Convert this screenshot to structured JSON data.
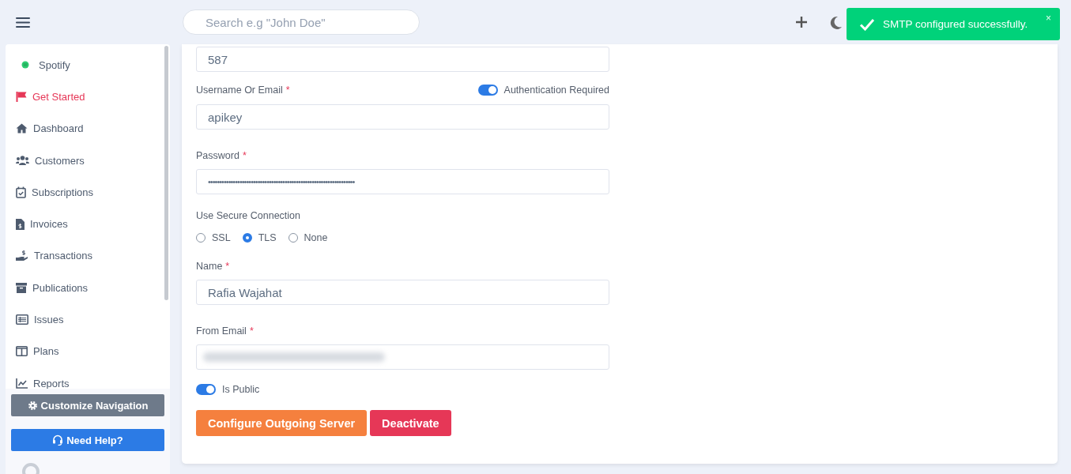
{
  "header": {
    "search": {
      "placeholder": "Search e.g \"John Doe\""
    }
  },
  "toast": {
    "message": "SMTP configured successfully.",
    "close": "×"
  },
  "sidebar": {
    "items": [
      {
        "label": "Spotify",
        "kind": "workspace",
        "selected": false
      },
      {
        "label": "Get Started",
        "kind": "link",
        "selected": true
      },
      {
        "label": "Dashboard",
        "kind": "link",
        "selected": false
      },
      {
        "label": "Customers",
        "kind": "link",
        "selected": false
      },
      {
        "label": "Subscriptions",
        "kind": "link",
        "selected": false
      },
      {
        "label": "Invoices",
        "kind": "link",
        "selected": false
      },
      {
        "label": "Transactions",
        "kind": "link",
        "selected": false
      },
      {
        "label": "Publications",
        "kind": "link",
        "selected": false
      },
      {
        "label": "Issues",
        "kind": "link",
        "selected": false
      },
      {
        "label": "Plans",
        "kind": "link",
        "selected": false
      },
      {
        "label": "Reports",
        "kind": "link",
        "selected": false
      }
    ],
    "customize_button": "Customize Navigation",
    "help_button": "Need Help?"
  },
  "form": {
    "port": {
      "value": "587"
    },
    "username": {
      "label": "Username Or Email",
      "required_mark": "*",
      "value": "apikey"
    },
    "auth_toggle": {
      "label": "Authentication Required",
      "on": true
    },
    "password": {
      "label": "Password",
      "required_mark": "*",
      "value": "•••••••••••••••••••••••••••••••••••••••••••••••••••••••••••••••••"
    },
    "secure_connection": {
      "label": "Use Secure Connection",
      "options": [
        {
          "label": "SSL",
          "selected": false
        },
        {
          "label": "TLS",
          "selected": true
        },
        {
          "label": "None",
          "selected": false
        }
      ]
    },
    "name": {
      "label": "Name",
      "required_mark": "*",
      "value": "Rafia Wajahat"
    },
    "from_email": {
      "label": "From Email",
      "required_mark": "*",
      "blurred": true
    },
    "is_public": {
      "label": "Is Public",
      "on": true
    },
    "buttons": [
      {
        "label": "Configure Outgoing Server",
        "kind": "primary"
      },
      {
        "label": "Deactivate",
        "kind": "danger"
      }
    ]
  }
}
